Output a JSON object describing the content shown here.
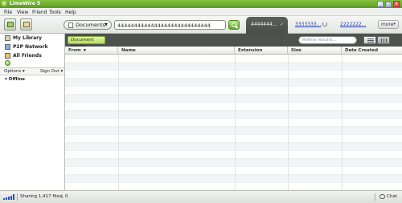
{
  "window": {
    "title": "LimeWire 5",
    "minimize": "_",
    "maximize": "□",
    "close": "x"
  },
  "menu": [
    "File",
    "View",
    "Friend",
    "Tools",
    "Help"
  ],
  "toolbar": {
    "scope_label": "Documents",
    "search_value": "4444444444444444444444444444"
  },
  "tabs": {
    "active_label": "4444444...",
    "active_close": "✓",
    "tab2_label": "3333333...",
    "tab3_label": "2222222...",
    "more_label": "more"
  },
  "sidebar": {
    "library": [
      {
        "label": "My Library",
        "icon": "library-icon"
      },
      {
        "label": "P2P Network",
        "icon": "p2p-network-icon"
      },
      {
        "label": "All Friends",
        "icon": "friends-icon"
      }
    ],
    "options_label": "Options ▾",
    "signout_label": "Sign Out ▾",
    "friends_group": "▾ Offline"
  },
  "results": {
    "badge_label": "Document results",
    "refine_placeholder": "Refine results...",
    "columns": [
      "From",
      "Name",
      "Extension",
      "Size",
      "Date Created"
    ],
    "sort_indicator": "▼"
  },
  "status": {
    "sharing": "Sharing 1,417 files",
    "downloads": "0",
    "chat": "Chat"
  },
  "colors": {
    "brand_green": "#5b9a1f",
    "header_dark": "#4e514e",
    "link_blue": "#1a3fc0"
  }
}
